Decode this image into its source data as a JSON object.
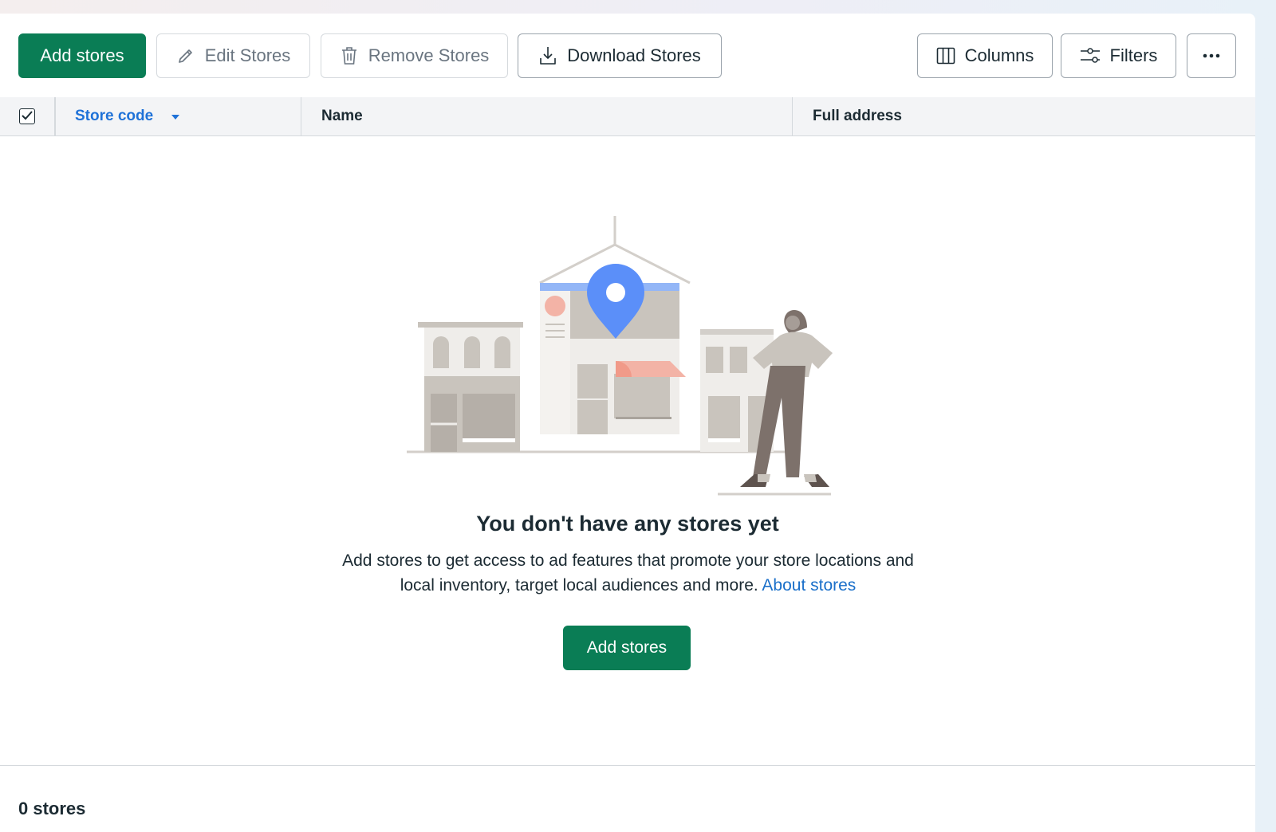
{
  "toolbar": {
    "add_label": "Add stores",
    "edit_label": "Edit Stores",
    "remove_label": "Remove Stores",
    "download_label": "Download Stores",
    "columns_label": "Columns",
    "filters_label": "Filters",
    "more_label": "···"
  },
  "table": {
    "columns": [
      "Store code",
      "Name",
      "Full address"
    ],
    "sort_column": "Store code",
    "select_all_checked": true
  },
  "empty_state": {
    "title": "You don't have any stores yet",
    "description": "Add stores to get access to ad features that promote your store locations and local inventory, target local audiences and more.",
    "link_label": "About stores",
    "button_label": "Add stores"
  },
  "footer": {
    "count_label": "0 stores"
  },
  "colors": {
    "primary": "#0a7d55",
    "link": "#1a6fc9",
    "sort_header": "#1f72d8",
    "pin": "#5b8ff9",
    "awning": "#f3b3a6"
  },
  "icons": [
    "pencil-icon",
    "trash-icon",
    "download-icon",
    "columns-icon",
    "filters-icon",
    "more-icon",
    "sort-caret-icon",
    "check-icon"
  ]
}
